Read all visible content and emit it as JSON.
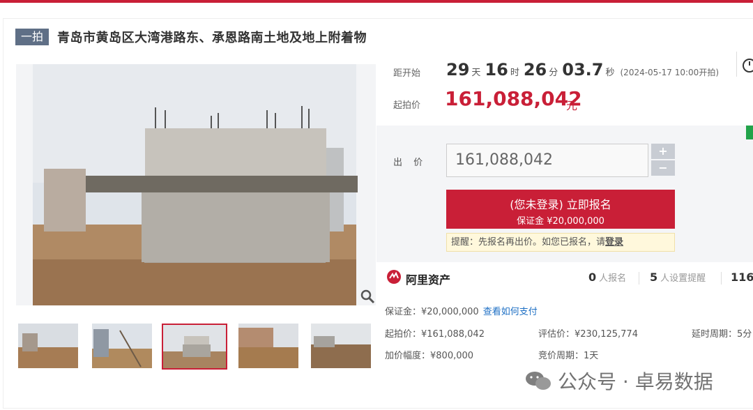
{
  "item": {
    "badge": "一拍",
    "title": "青岛市黄岛区大湾港路东、承恩路南土地及地上附着物"
  },
  "countdown": {
    "label": "距开始",
    "days": "29",
    "days_unit": "天",
    "hours": "16",
    "hours_unit": "时",
    "minutes": "26",
    "minutes_unit": "分",
    "seconds": "03.7",
    "seconds_unit": "秒",
    "start_text": "(2024-05-17 10:00开拍)"
  },
  "starting_price": {
    "label": "起拍价",
    "value": "161,088,042",
    "unit": "元"
  },
  "bid": {
    "label": "出 价",
    "value": "161,088,042",
    "plus": "+",
    "minus": "−",
    "signup_line1": "(您未登录) 立即报名",
    "signup_line2": "保证金 ¥20,000,000",
    "reminder_prefix": "提醒：先报名再出价。如您已报名，请",
    "reminder_link": "登录"
  },
  "platform": {
    "name": "阿里资产",
    "registered_count": "0",
    "registered_label": "人报名",
    "reminder_count": "5",
    "reminder_label": "人设置提醒",
    "views_count": "116"
  },
  "details": {
    "deposit": "保证金：¥20,000,000",
    "how_to_pay": "查看如何支付",
    "start_price": "起拍价：¥161,088,042",
    "appraisal": "评估价：¥230,125,774",
    "delay": "延时周期：5分",
    "increment": "加价幅度：¥800,000",
    "cycle": "竞价周期：1天"
  },
  "watermark": {
    "text": "公众号 · 卓易数据"
  },
  "colors": {
    "accent": "#c91f37",
    "badge": "#5f6f86",
    "link": "#1d6fc4"
  }
}
